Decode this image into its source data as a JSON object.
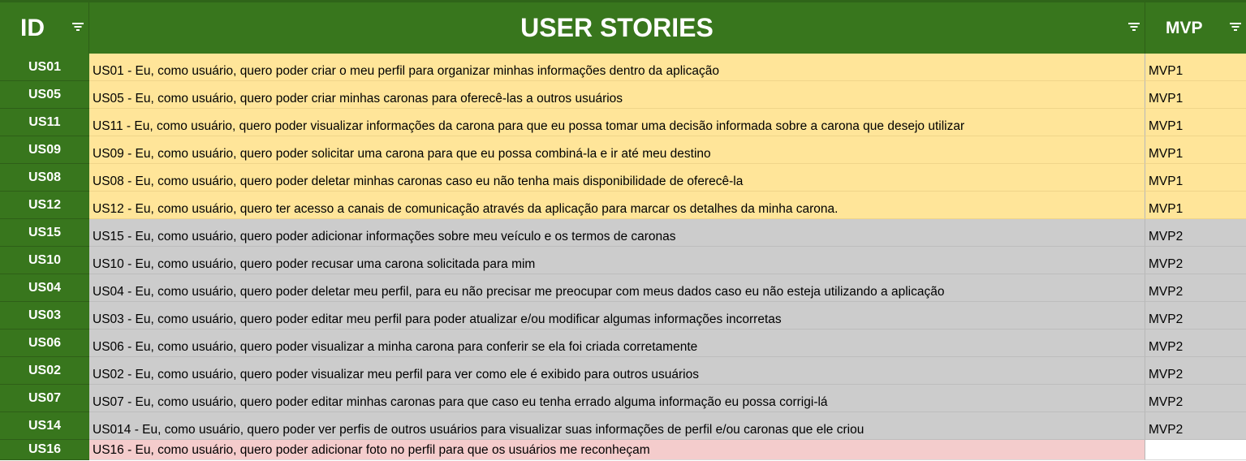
{
  "header": {
    "id_label": "ID",
    "stories_label": "USER STORIES",
    "mvp_label": "MVP",
    "filter_icon": "filter-icon"
  },
  "colors": {
    "header_green": "#38761d",
    "mvp1_yellow": "#ffe599",
    "mvp2_gray": "#cccccc",
    "unassigned_pink": "#f4cccc"
  },
  "rows": [
    {
      "id": "US01",
      "story": "US01 - Eu, como usuário, quero poder criar o meu perfil para organizar minhas informações dentro da aplicação",
      "mvp": "MVP1"
    },
    {
      "id": "US05",
      "story": "US05 - Eu, como usuário, quero poder criar minhas caronas para oferecê-las a outros usuários",
      "mvp": "MVP1"
    },
    {
      "id": "US11",
      "story": "US11 - Eu, como usuário, quero poder visualizar informações da carona para que eu possa tomar uma decisão informada sobre a carona que desejo utilizar",
      "mvp": "MVP1"
    },
    {
      "id": "US09",
      "story": "US09 - Eu, como usuário, quero poder solicitar uma carona para que eu possa combiná-la e ir até meu destino",
      "mvp": "MVP1"
    },
    {
      "id": "US08",
      "story": "US08 - Eu, como usuário, quero poder deletar minhas caronas caso eu não tenha mais disponibilidade de oferecê-la",
      "mvp": "MVP1"
    },
    {
      "id": "US12",
      "story": "US12 - Eu, como usuário, quero ter acesso a canais de comunicação através da aplicação para marcar os detalhes da minha carona.",
      "mvp": "MVP1"
    },
    {
      "id": "US15",
      "story": "US15 - Eu, como usuário, quero poder adicionar informações sobre meu veículo e os termos de caronas",
      "mvp": "MVP2"
    },
    {
      "id": "US10",
      "story": "US10 - Eu, como usuário, quero poder recusar uma carona solicitada para mim",
      "mvp": "MVP2"
    },
    {
      "id": "US04",
      "story": "US04 - Eu, como usuário, quero poder deletar meu perfil, para eu não precisar me preocupar com meus dados caso eu não esteja utilizando a aplicação",
      "mvp": "MVP2"
    },
    {
      "id": "US03",
      "story": "US03 - Eu, como usuário, quero poder editar meu perfil para poder atualizar e/ou modificar algumas informações incorretas",
      "mvp": "MVP2"
    },
    {
      "id": "US06",
      "story": "US06 - Eu, como usuário, quero poder visualizar a minha carona para conferir se ela foi criada corretamente",
      "mvp": "MVP2"
    },
    {
      "id": "US02",
      "story": "US02 - Eu, como usuário, quero poder visualizar meu perfil para ver como ele é exibido para outros usuários",
      "mvp": "MVP2"
    },
    {
      "id": "US07",
      "story": "US07 - Eu, como usuário, quero poder editar minhas caronas para que caso eu tenha errado alguma informação eu possa corrigi-lá",
      "mvp": "MVP2"
    },
    {
      "id": "US14",
      "story": "US014 - Eu, como usuário, quero poder ver perfis de outros usuários para visualizar suas informações de perfil e/ou caronas que ele criou",
      "mvp": "MVP2"
    },
    {
      "id": "US16",
      "story": "US16 - Eu, como usuário, quero poder adicionar foto no perfil para que os usuários me reconheçam",
      "mvp": ""
    }
  ]
}
